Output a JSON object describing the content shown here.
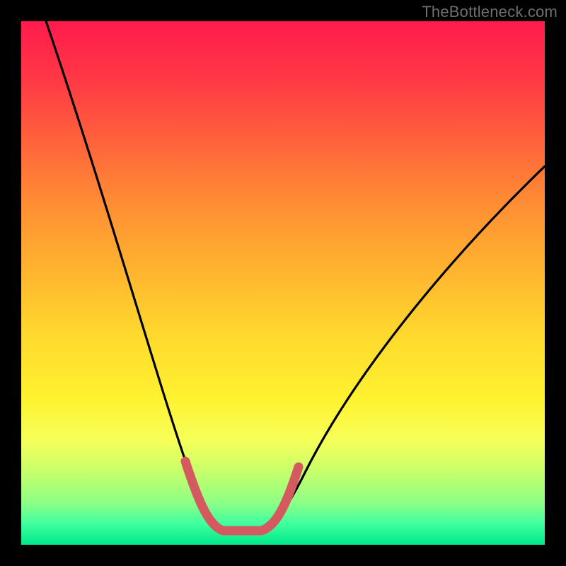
{
  "watermark": {
    "text": "TheBottleneck.com"
  },
  "colors": {
    "frame": "#000000",
    "curve": "#000000",
    "highlight": "#d45a5f"
  },
  "chart_data": {
    "type": "line",
    "title": "",
    "xlabel": "",
    "ylabel": "",
    "xlim": [
      0,
      100
    ],
    "ylim": [
      0,
      100
    ],
    "x": [
      0,
      5,
      10,
      15,
      20,
      25,
      28,
      30,
      32,
      34,
      36,
      38,
      40,
      42,
      44,
      46,
      50,
      55,
      60,
      65,
      70,
      75,
      80,
      85,
      90,
      95,
      100
    ],
    "values": [
      100,
      86,
      71,
      56,
      41,
      26,
      16,
      10,
      6,
      3,
      2,
      2,
      2,
      2,
      3,
      5,
      10,
      17,
      24,
      31,
      38,
      45,
      51,
      57,
      62,
      67,
      72
    ],
    "highlight_range_x": [
      30,
      46
    ],
    "note": "Values are bottleneck percentage (y, 0=bottom/green, 100=top/red) vs normalized x position. Pink highlight marks the flat near-zero segment."
  }
}
